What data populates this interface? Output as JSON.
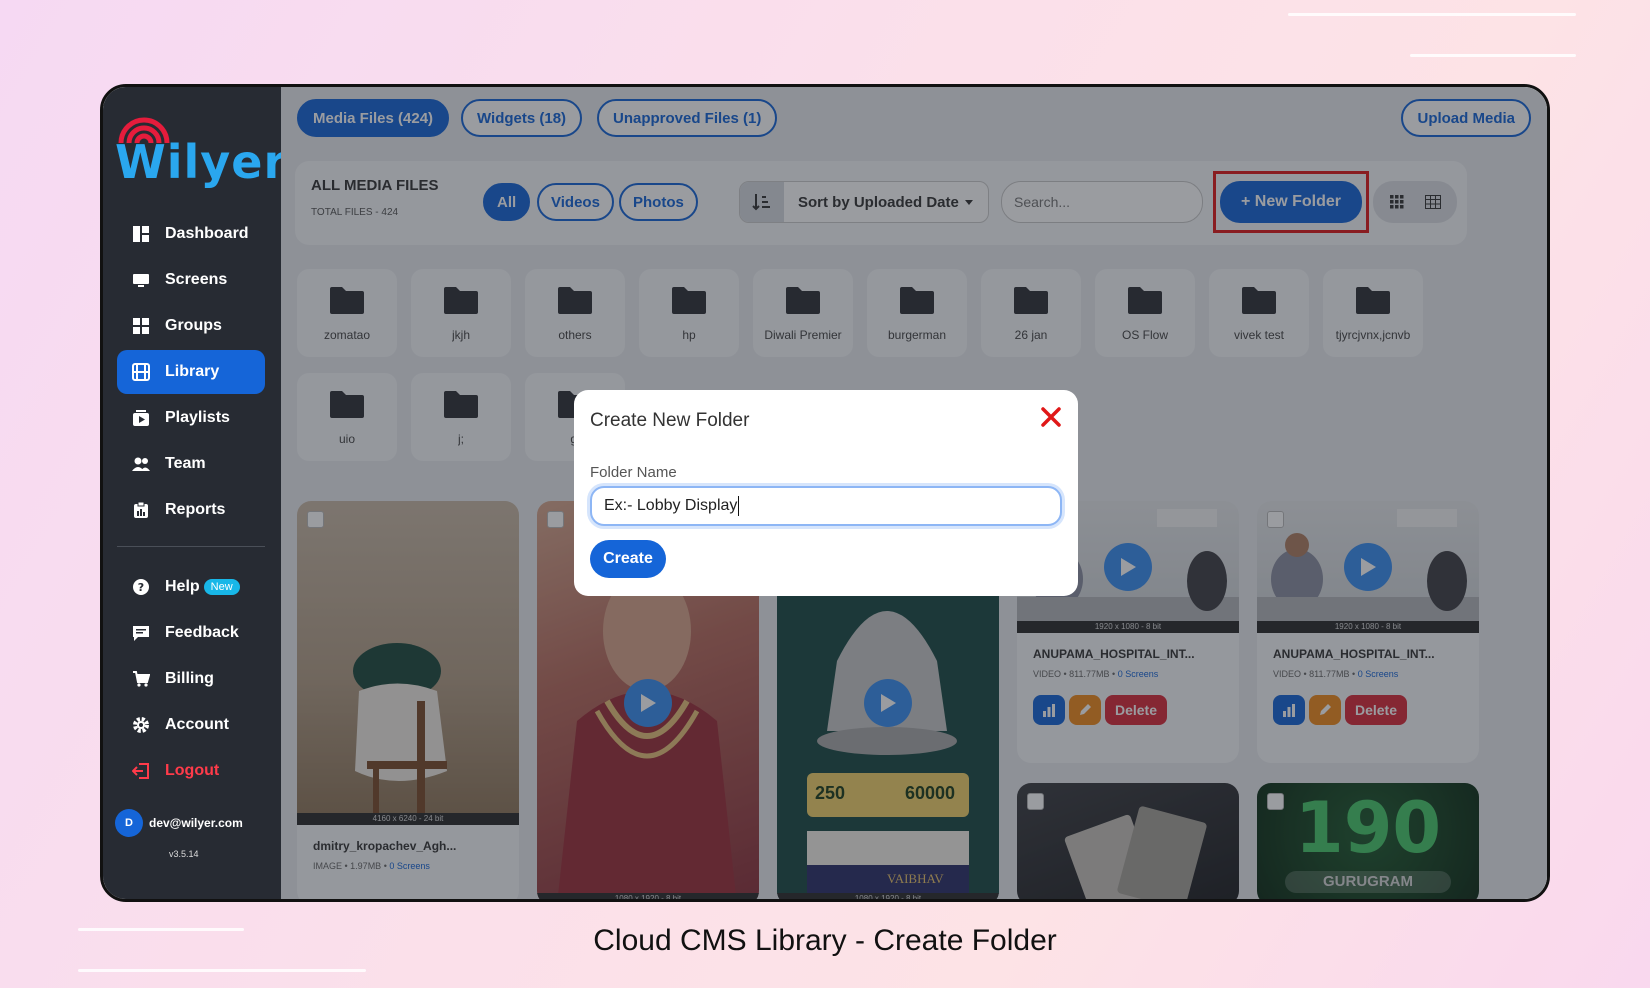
{
  "sidebar": {
    "logo": "Wilyer",
    "items": [
      {
        "label": "Dashboard",
        "icon": "dashboard-icon"
      },
      {
        "label": "Screens",
        "icon": "monitor-icon"
      },
      {
        "label": "Groups",
        "icon": "grid-icon"
      },
      {
        "label": "Library",
        "icon": "film-icon",
        "active": true
      },
      {
        "label": "Playlists",
        "icon": "playlist-icon"
      },
      {
        "label": "Team",
        "icon": "users-icon"
      },
      {
        "label": "Reports",
        "icon": "clipboard-icon"
      }
    ],
    "secondary": [
      {
        "label": "Help",
        "icon": "help-icon",
        "badge": "New"
      },
      {
        "label": "Feedback",
        "icon": "feedback-icon"
      },
      {
        "label": "Billing",
        "icon": "cart-icon"
      },
      {
        "label": "Account",
        "icon": "gear-icon"
      },
      {
        "label": "Logout",
        "icon": "logout-icon"
      }
    ],
    "user": {
      "initial": "D",
      "email": "dev@wilyer.com",
      "version": "v3.5.14"
    }
  },
  "header": {
    "tabs": [
      "Media Files (424)",
      "Widgets (18)",
      "Unapproved Files (1)"
    ],
    "upload": "Upload Media"
  },
  "toolbar": {
    "title": "ALL MEDIA FILES",
    "subtitle": "TOTAL FILES - 424",
    "filters": [
      "All",
      "Videos",
      "Photos"
    ],
    "sort": "Sort by Uploaded Date",
    "search_placeholder": "Search...",
    "new_folder": "+ New Folder"
  },
  "folders": [
    "zomatao",
    "jkjh",
    "others",
    "hp",
    "Diwali Premier",
    "burgerman",
    "26 jan",
    "OS Flow",
    "vivek test",
    "tjyrcjvnx,jcnvb",
    "uio",
    "j;",
    "gl"
  ],
  "cards": [
    {
      "res": "4160 x 6240 - 24 bit",
      "title": "dmitry_kropachev_Agh...",
      "type": "IMAGE",
      "size": "1.97MB",
      "screens": "0 Screens"
    },
    {
      "res": "1080 x 1920 - 8 bit"
    },
    {
      "res": "1080 x 1920 - 8 bit",
      "text_a": "250",
      "text_b": "60000",
      "text_c": "VAIBHAV"
    },
    {
      "res": "1920 x 1080 - 8 bit",
      "title": "ANUPAMA_HOSPITAL_INT...",
      "type": "VIDEO",
      "size": "811.77MB",
      "screens": "0 Screens",
      "delete": "Delete"
    },
    {
      "res": "1920 x 1080 - 8 bit",
      "title": "ANUPAMA_HOSPITAL_INT...",
      "type": "VIDEO",
      "size": "811.77MB",
      "screens": "0 Screens",
      "delete": "Delete"
    },
    {},
    {
      "big": "190",
      "sub": "GURUGRAM"
    }
  ],
  "modal": {
    "title": "Create New Folder",
    "label": "Folder Name",
    "value": "Ex:- Lobby Display",
    "button": "Create"
  },
  "caption": "Cloud CMS Library - Create Folder",
  "colors": {
    "primary": "#1565d8",
    "danger": "#e01818",
    "sidebar": "#272b33",
    "logo": "#2aa7ef"
  }
}
